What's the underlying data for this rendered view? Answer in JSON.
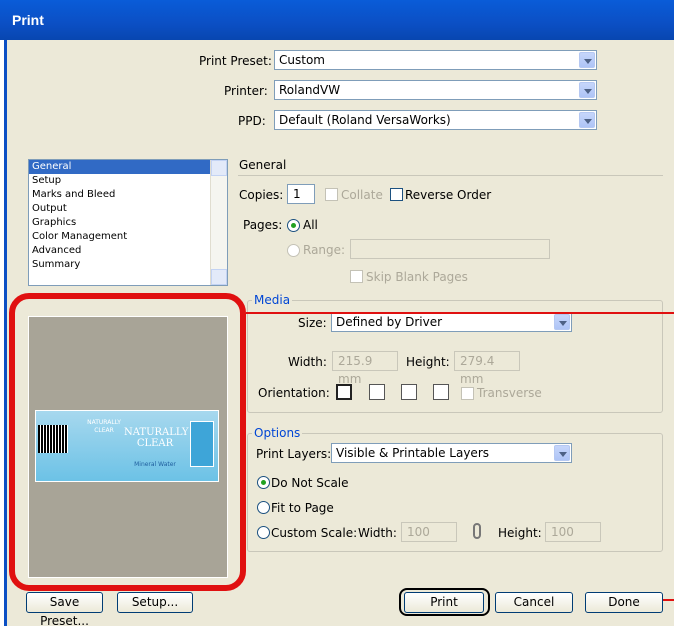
{
  "window": {
    "title": "Print"
  },
  "top": {
    "preset_label": "Print Preset:",
    "preset_value": "Custom",
    "printer_label": "Printer:",
    "printer_value": "RolandVW",
    "ppd_label": "PPD:",
    "ppd_value": "Default (Roland VersaWorks)"
  },
  "sidebar": {
    "items": [
      {
        "label": "General",
        "selected": true
      },
      {
        "label": "Setup"
      },
      {
        "label": "Marks and Bleed"
      },
      {
        "label": "Output"
      },
      {
        "label": "Graphics"
      },
      {
        "label": "Color Management"
      },
      {
        "label": "Advanced"
      },
      {
        "label": "Summary"
      }
    ]
  },
  "general": {
    "heading": "General",
    "copies_label": "Copies:",
    "copies_value": "1",
    "collate_label": "Collate",
    "reverse_label": "Reverse Order",
    "pages_label": "Pages:",
    "all_label": "All",
    "range_label": "Range:",
    "skip_label": "Skip Blank Pages"
  },
  "media": {
    "title": "Media",
    "size_label": "Size:",
    "size_value": "Defined by Driver",
    "width_label": "Width:",
    "width_value": "215.9 mm",
    "height_label": "Height:",
    "height_value": "279.4 mm",
    "orientation_label": "Orientation:",
    "transverse_label": "Transverse"
  },
  "options": {
    "title": "Options",
    "layers_label": "Print Layers:",
    "layers_value": "Visible & Printable Layers",
    "no_scale_label": "Do Not Scale",
    "fit_label": "Fit to Page",
    "custom_label": "Custom Scale:",
    "width_label": "Width:",
    "width_value": "100",
    "height_label": "Height:",
    "height_value": "100"
  },
  "preview_label": {
    "brand_line1": "NATURALLY",
    "brand_line2": "CLEAR",
    "small_brand": "NATURALLY CLEAR",
    "subtitle": "Mineral Water"
  },
  "buttons": {
    "save_preset": "Save Preset...",
    "setup": "Setup...",
    "print": "Print",
    "cancel": "Cancel",
    "done": "Done"
  },
  "colors": {
    "highlight": "#e01010",
    "title_bar": "#0b4fc4",
    "group_title": "#0046d5"
  }
}
